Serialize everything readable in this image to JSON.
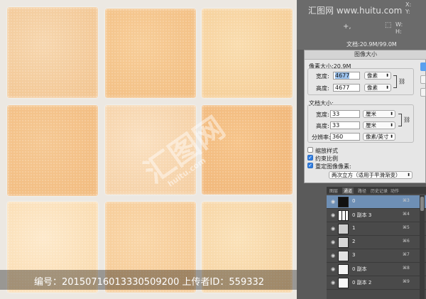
{
  "canvas": {
    "tiles": [
      {
        "color_a": "#f6d6ae",
        "color_b": "#f2c48f"
      },
      {
        "color_a": "#f7cd98",
        "color_b": "#f2bd80"
      },
      {
        "color_a": "#f9dcae",
        "color_b": "#f5cc94"
      },
      {
        "color_a": "#f5c893",
        "color_b": "#f2bb7e"
      },
      {
        "color_a": "#fae0c0",
        "color_b": "#f4cda0"
      },
      {
        "color_a": "#f6c48a",
        "color_b": "#f0b577"
      },
      {
        "color_a": "#fde9cb",
        "color_b": "#f9d9ab"
      },
      {
        "color_a": "#f9d6a8",
        "color_b": "#f5c892"
      },
      {
        "color_a": "#fae1b8",
        "color_b": "#f6d09c"
      }
    ]
  },
  "watermark": {
    "center_logo": "汇图网",
    "center_url": "huitu.com",
    "bottom_text": "编号：20150716013330509200 上传者ID：559332",
    "brand": "汇图网 www.huitu.com"
  },
  "info_panel": {
    "x_label": "X:",
    "y_label": "Y:",
    "w_label": "W:",
    "h_label": "H:",
    "doc_size": "文档:20.9M/99.0M"
  },
  "dialog": {
    "title": "图像大小",
    "pixel_dim_label": "像素大小:20.9M",
    "width_label": "宽度:",
    "width_value": "4677",
    "width_unit": "像素",
    "height_label": "高度:",
    "height_value": "4677",
    "height_unit": "像素",
    "doc_size_label": "文档大小:",
    "doc_width_label": "宽度:",
    "doc_width_value": "33",
    "doc_width_unit": "厘米",
    "doc_height_label": "高度:",
    "doc_height_value": "33",
    "doc_height_unit": "厘米",
    "resolution_label": "分辨率:",
    "resolution_value": "360",
    "resolution_unit": "像素/英寸",
    "scale_styles": {
      "label": "缩放样式",
      "checked": false
    },
    "constrain": {
      "label": "约束比例",
      "checked": true
    },
    "resample": {
      "label": "重定图像像素:",
      "checked": true
    },
    "resample_method": "两次立方（适用于平滑渐变）"
  },
  "layers": {
    "tabs": [
      "图层",
      "通道",
      "路径",
      "历史记录",
      "动作"
    ],
    "active_tab": "通道",
    "rows": [
      {
        "name": "0",
        "shortcut": "⌘3",
        "active": true,
        "thumb": "#111"
      },
      {
        "name": "0 副本 3",
        "shortcut": "⌘4",
        "active": false,
        "thumb": "#e8e8e8"
      },
      {
        "name": "1",
        "shortcut": "⌘5",
        "active": false,
        "thumb": "#cfcfcf"
      },
      {
        "name": "2",
        "shortcut": "⌘6",
        "active": false,
        "thumb": "#d8d8d8"
      },
      {
        "name": "3",
        "shortcut": "⌘7",
        "active": false,
        "thumb": "#e2e2e2"
      },
      {
        "name": "0 副本",
        "shortcut": "⌘8",
        "active": false,
        "thumb": "#f4f4f4"
      },
      {
        "name": "0 副本 2",
        "shortcut": "⌘9",
        "active": false,
        "thumb": "#f8f8f8"
      }
    ]
  }
}
